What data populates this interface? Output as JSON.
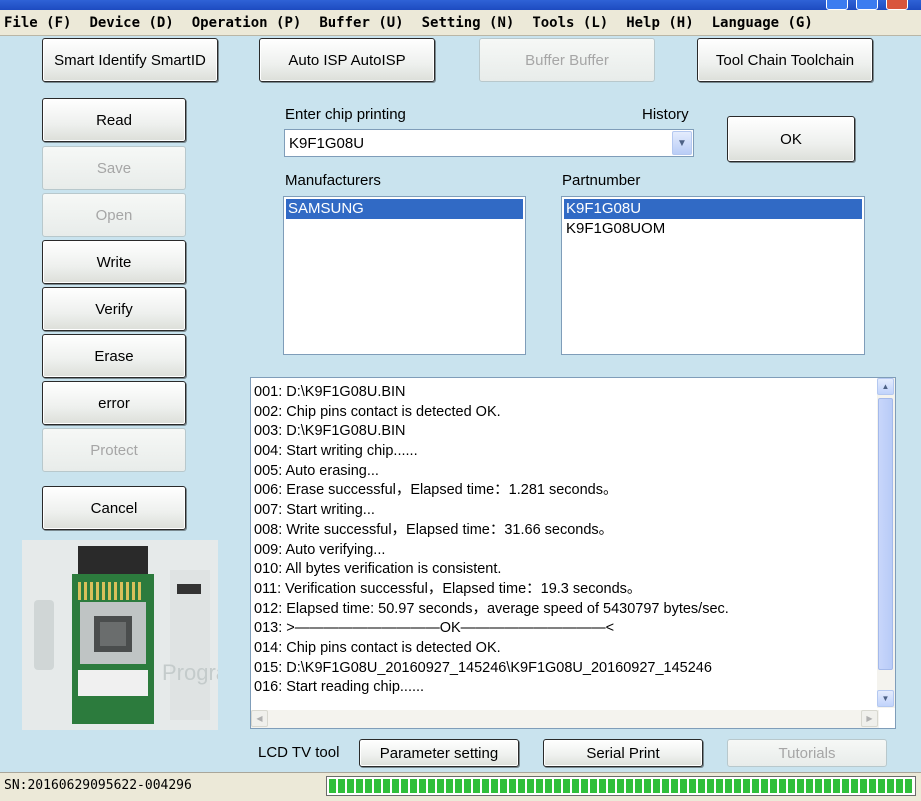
{
  "menubar": {
    "items": [
      "File (F)",
      "Device (D)",
      "Operation (P)",
      "Buffer (U)",
      "Setting (N)",
      "Tools (L)",
      "Help (H)",
      "Language (G)"
    ]
  },
  "toolbar": {
    "smart_identify": "Smart Identify SmartID",
    "auto_isp": "Auto ISP AutoISP",
    "buffer": "Buffer Buffer",
    "tool_chain": "Tool Chain Toolchain"
  },
  "sidebar": {
    "read": "Read",
    "save": "Save",
    "open": "Open",
    "write": "Write",
    "verify": "Verify",
    "erase": "Erase",
    "error": "error",
    "protect": "Protect",
    "cancel": "Cancel"
  },
  "chip": {
    "enter_label": "Enter chip printing",
    "history_label": "History",
    "value": "K9F1G08U",
    "ok": "OK",
    "manufacturers_label": "Manufacturers",
    "partnumber_label": "Partnumber",
    "manufacturers": [
      "SAMSUNG"
    ],
    "partnumbers": [
      "K9F1G08U",
      "K9F1G08UOM"
    ]
  },
  "log": {
    "lines": [
      "001:  D:\\K9F1G08U.BIN",
      "002:  Chip pins contact is detected OK.",
      "003:  D:\\K9F1G08U.BIN",
      "004:  Start writing chip......",
      "005:  Auto erasing...",
      "006:  Erase successful，Elapsed time：1.281 seconds。",
      "007:  Start writing...",
      "008:  Write successful，Elapsed time：31.66 seconds。",
      "009:  Auto verifying...",
      "010:  All bytes verification is consistent.",
      "011:  Verification successful，Elapsed time：19.3 seconds。",
      "012:  Elapsed time: 50.97 seconds，average speed of 5430797 bytes/sec.",
      "013:  >——————————OK——————————<",
      "014:  Chip pins contact is detected OK.",
      "015:  D:\\K9F1G08U_20160927_145246\\K9F1G08U_20160927_145246",
      "016:  Start reading chip......"
    ]
  },
  "bottom": {
    "lcd_label": "LCD TV tool",
    "parameter_setting": "Parameter setting",
    "serial_print": "Serial Print",
    "tutorials": "Tutorials"
  },
  "status": {
    "sn": "SN:20160629095622-004296",
    "progress": 1.0
  },
  "colors": {
    "background": "#c9e3ee",
    "selection": "#316ac5",
    "progress": "#2fbf3a"
  }
}
